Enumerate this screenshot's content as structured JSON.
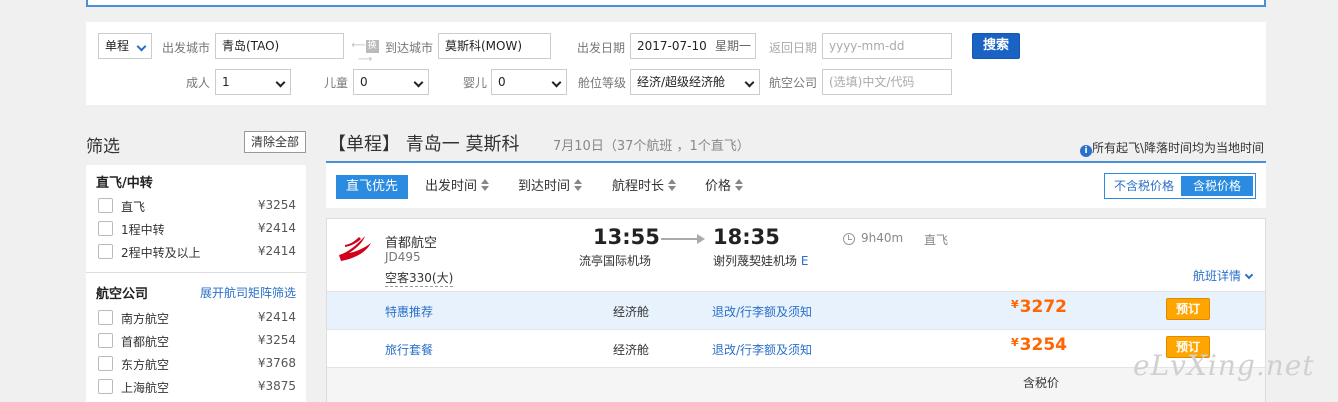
{
  "search": {
    "trip_type": "单程",
    "depart_city_label": "出发城市",
    "depart_city_value": "青岛(TAO)",
    "swap_label": "换",
    "arrive_city_label": "到达城市",
    "arrive_city_value": "莫斯科(MOW)",
    "depart_date_label": "出发日期",
    "depart_date_value": "2017-07-10",
    "depart_weekday": "星期一",
    "return_date_label": "返回日期",
    "return_date_placeholder": "yyyy-mm-dd",
    "search_button": "搜索",
    "adult_label": "成人",
    "adult_value": "1",
    "child_label": "儿童",
    "child_value": "0",
    "infant_label": "婴儿",
    "infant_value": "0",
    "cabin_label": "舱位等级",
    "cabin_value": "经济/超级经济舱",
    "airline_label": "航空公司",
    "airline_placeholder": "(选填)中文/代码"
  },
  "filter": {
    "title": "筛选",
    "clear_all": "清除全部",
    "direct_section": {
      "title": "直飞/中转",
      "items": [
        {
          "label": "直飞",
          "price": "¥3254"
        },
        {
          "label": "1程中转",
          "price": "¥2414"
        },
        {
          "label": "2程中转及以上",
          "price": "¥2414"
        }
      ]
    },
    "airline_section": {
      "title": "航空公司",
      "expand_link": "展开航司矩阵筛选",
      "items": [
        {
          "label": "南方航空",
          "price": "¥2414"
        },
        {
          "label": "首都航空",
          "price": "¥3254"
        },
        {
          "label": "东方航空",
          "price": "¥3768"
        },
        {
          "label": "上海航空",
          "price": "¥3875"
        }
      ]
    }
  },
  "results": {
    "title": "【单程】 青岛一 莫斯科",
    "subtitle": "7月10日（37个航班 ，1个直飞）",
    "timezone_note": "所有起飞\\降落时间均为当地时间",
    "sort": {
      "direct_first": "直飞优先",
      "depart_time": "出发时间",
      "arrive_time": "到达时间",
      "duration": "航程时长",
      "price": "价格",
      "exclude_tax": "不含税价格",
      "include_tax": "含税价格"
    },
    "flight": {
      "airline": "首都航空",
      "flight_no": "JD495",
      "aircraft": "空客330(大)",
      "depart_time": "13:55",
      "depart_airport": "流亭国际机场",
      "arrive_time": "18:35",
      "arrive_airport": "谢列蔑契娃机场",
      "arrive_terminal": "E",
      "duration": "9h40m",
      "stops": "直飞",
      "details_link": "航班详情",
      "fares": [
        {
          "name": "特惠推荐",
          "cabin": "经济舱",
          "rules": "退改/行李额及须知",
          "currency": "¥",
          "price": "3272",
          "book": "预订"
        },
        {
          "name": "旅行套餐",
          "cabin": "经济舱",
          "rules": "退改/行李额及须知",
          "currency": "¥",
          "price": "3254",
          "book": "预订"
        }
      ],
      "tax_note": "含税价"
    }
  },
  "watermark": "eLvXing.net",
  "colors": {
    "accent": "#2a8be0",
    "price": "#ff6600",
    "book": "#ffa500",
    "search_btn": "#1a63c5"
  }
}
